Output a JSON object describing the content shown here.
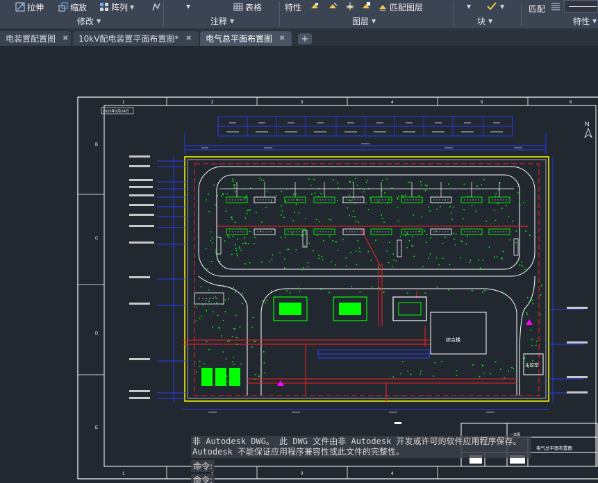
{
  "ribbon": {
    "modify": {
      "stretch": "拉伸",
      "scale": "缩放",
      "array": "阵列",
      "title": "修改"
    },
    "annotation": {
      "table": "表格",
      "title": "注释"
    },
    "layers": {
      "properties": "特性",
      "match_layer": "匹配图层",
      "title": "图层"
    },
    "block": {
      "title": "块"
    },
    "props": {
      "match": "匹配",
      "title": "特性"
    }
  },
  "tabs": [
    {
      "label": "电装置配置图"
    },
    {
      "label": "10kV配电装置平面布置图*"
    },
    {
      "label": "电气总平面布置图"
    }
  ],
  "tab_add": "+",
  "drawing": {
    "date": "2023年2月24日",
    "north_mark": "N",
    "title_block_name": "电气总平面布置图",
    "title_block_code": "一本图",
    "col_labels": [
      "1",
      "2",
      "3",
      "4",
      "5",
      "6"
    ],
    "row_labels": [
      "B",
      "C",
      "D",
      "E"
    ],
    "right_room": "主控室",
    "center_room": "综合楼",
    "table_header": "设备明细"
  },
  "command": {
    "message_line1": "非 Autodesk DWG。 此 DWG 文件由非 Autodesk 开发或许可的软件应用程序保存。",
    "message_line2": "Autodesk 不能保证应用程序兼容性或此文件的完整性。",
    "prompt1": "命令:",
    "prompt2": "命令:"
  },
  "colors": {
    "background": "#212830",
    "frame": "#ffffff",
    "yellow": "#ffff00",
    "red": "#ff2020",
    "blue": "#2a3cff",
    "green": "#00ff00",
    "magenta": "#ff00ff"
  }
}
